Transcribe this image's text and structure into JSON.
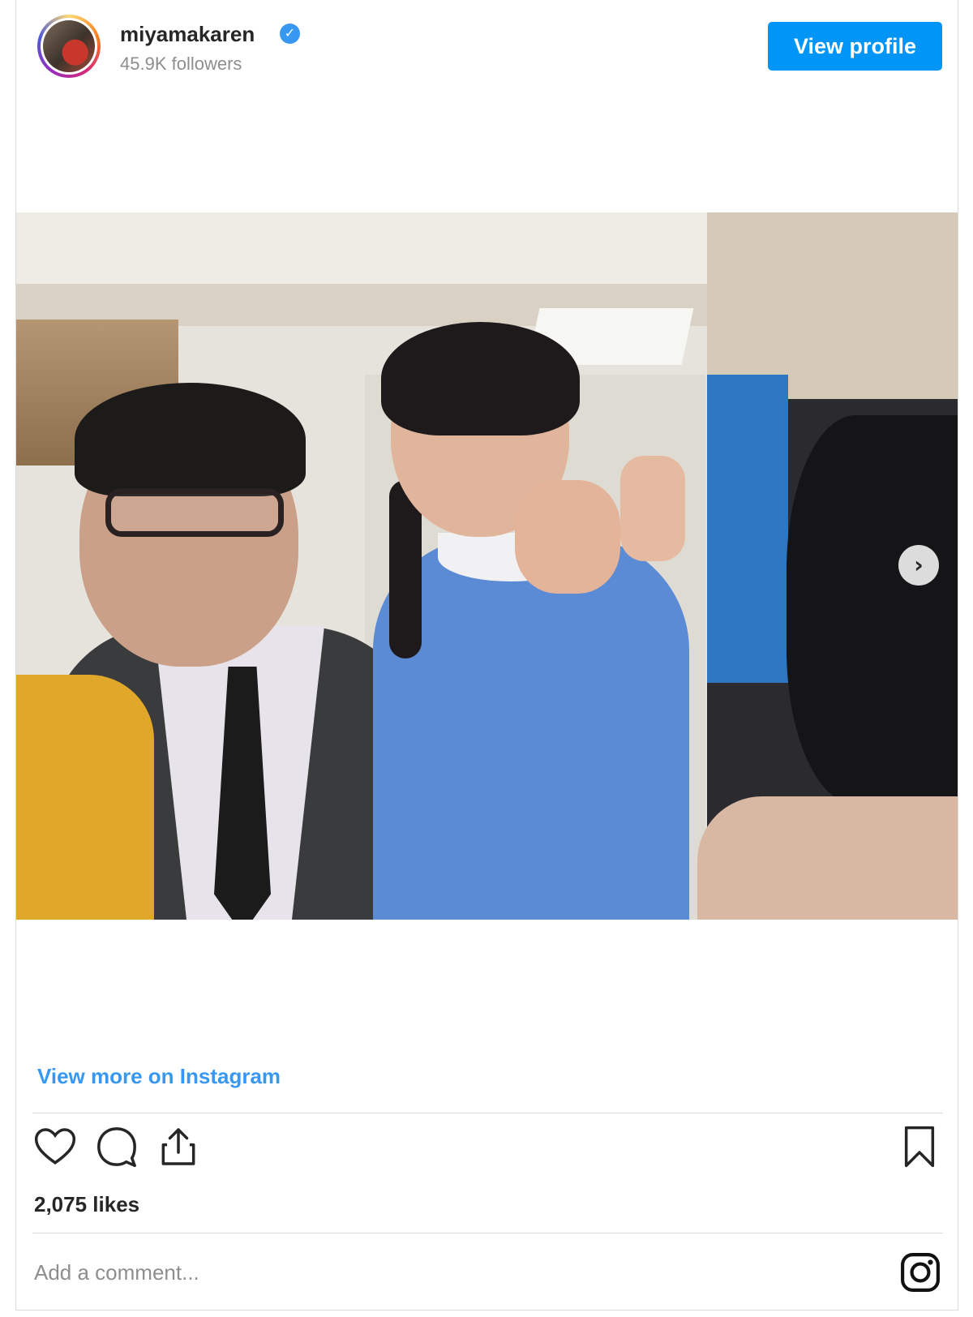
{
  "header": {
    "username": "miyamakaren",
    "followers": "45.9K followers",
    "view_profile_label": "View profile"
  },
  "media": {
    "next_arrow": "›"
  },
  "footer": {
    "view_more_label": "View more on Instagram",
    "likes": "2,075 likes",
    "comment_placeholder": "Add a comment..."
  },
  "icons": {
    "verified": "verified-badge-icon",
    "like": "heart-icon",
    "comment": "comment-bubble-icon",
    "share": "share-icon",
    "save": "bookmark-icon",
    "brand": "instagram-logo-icon",
    "next": "chevron-right-icon"
  },
  "colors": {
    "accent": "#0095f6",
    "link": "#3897f0",
    "verified": "#3897f0",
    "muted_text": "#8e8e8e",
    "border": "#dbdbdb"
  }
}
